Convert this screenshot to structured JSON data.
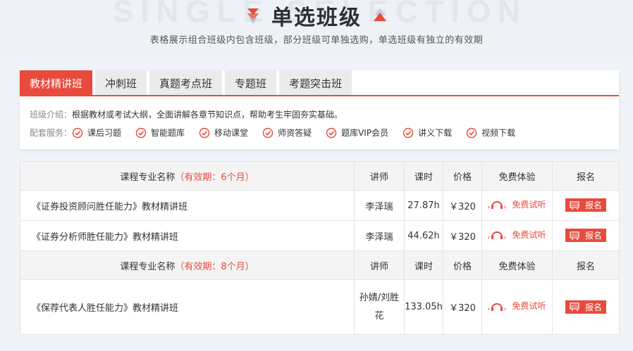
{
  "header": {
    "watermark": "SINGLE SELECTION",
    "title": "单选班级",
    "subtitle": "表格展示组合班级内包含班级，部分班级可单独选购，单选班级有独立的有效期"
  },
  "tabs": [
    "教材精讲班",
    "冲刺班",
    "真题考点班",
    "专题班",
    "考题突击班"
  ],
  "intro": {
    "label": "班级介绍：",
    "text": "根据教材或考试大纲，全面讲解各章节知识点，帮助考生牢固夯实基础。"
  },
  "services": {
    "label": "配套服务：",
    "items": [
      "课后习题",
      "智能题库",
      "移动课堂",
      "师资答疑",
      "题库VIP会员",
      "讲义下载",
      "视频下载"
    ]
  },
  "table": {
    "sections": [
      {
        "header": {
          "name": "课程专业名称",
          "validity": "（有效期：6个月）",
          "teacher": "讲师",
          "hours": "课时",
          "price": "价格",
          "trial": "免费体验",
          "enroll": "报名"
        },
        "rows": [
          {
            "name": "《证券投资顾问胜任能力》教材精讲班",
            "teacher": "李泽瑞",
            "hours": "27.87h",
            "price": "￥320",
            "trial": "免费试听",
            "enroll": "报名"
          },
          {
            "name": "《证券分析师胜任能力》教材精讲班",
            "teacher": "李泽瑞",
            "hours": "44.62h",
            "price": "￥320",
            "trial": "免费试听",
            "enroll": "报名"
          }
        ]
      },
      {
        "header": {
          "name": "课程专业名称",
          "validity": "（有效期：8个月）",
          "teacher": "讲师",
          "hours": "课时",
          "price": "价格",
          "trial": "免费体验",
          "enroll": "报名"
        },
        "rows": [
          {
            "name": "《保荐代表人胜任能力》教材精讲班",
            "teacher": "孙婧/刘胜花",
            "hours": "133.05h",
            "price": "￥320",
            "trial": "免费试听",
            "enroll": "报名"
          }
        ]
      }
    ]
  },
  "colors": {
    "accent": "#e84a3c",
    "header_bg": "#eef1f6"
  },
  "icons": {
    "title_left": "down-arrow-icon",
    "title_right": "up-arrow-icon",
    "service": "check-circle-icon",
    "trial": "headset-icon",
    "enroll": "cart-icon"
  }
}
